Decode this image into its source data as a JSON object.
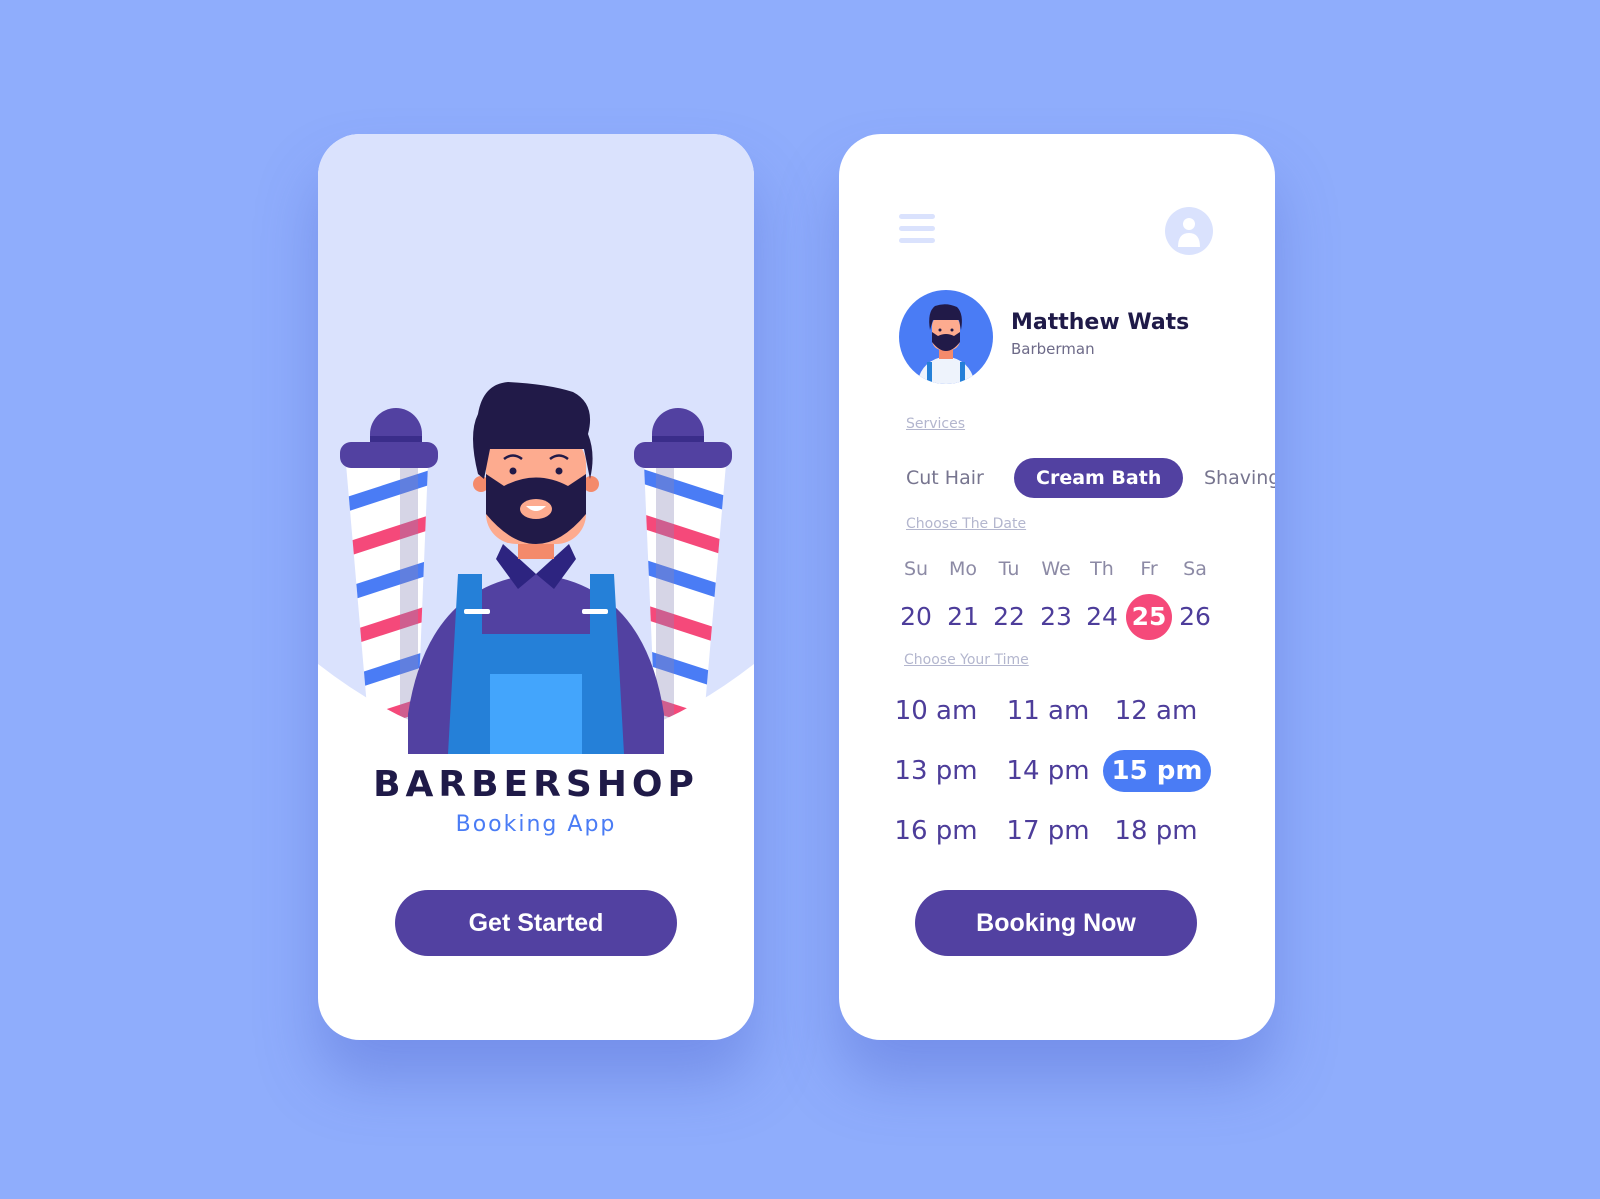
{
  "colors": {
    "background": "#8fadfc",
    "primary": "#5241a1",
    "accent_blue": "#4a7cf5",
    "accent_pink": "#f5497a",
    "hero_bg": "#dae2fd",
    "dark_text": "#1f1a48"
  },
  "welcome_screen": {
    "title": "BARBERSHOP",
    "subtitle": "Booking App",
    "cta_label": "Get Started",
    "illustration": "barber-man-with-barber-poles"
  },
  "booking_screen": {
    "menu_icon": "hamburger-menu-icon",
    "profile_icon": "user-profile-icon",
    "barber": {
      "name": "Matthew Wats",
      "role": "Barberman"
    },
    "services_label": "Services",
    "services": [
      {
        "label": "Cut Hair",
        "selected": false
      },
      {
        "label": "Cream Bath",
        "selected": true
      },
      {
        "label": "Shaving",
        "selected": false
      }
    ],
    "date_label": "Choose The Date",
    "days": [
      {
        "name": "Su",
        "num": "20",
        "selected": false
      },
      {
        "name": "Mo",
        "num": "21",
        "selected": false
      },
      {
        "name": "Tu",
        "num": "22",
        "selected": false
      },
      {
        "name": "We",
        "num": "23",
        "selected": false
      },
      {
        "name": "Th",
        "num": "24",
        "selected": false
      },
      {
        "name": "Fr",
        "num": "25",
        "selected": true
      },
      {
        "name": "Sa",
        "num": "26",
        "selected": false
      }
    ],
    "time_label": "Choose Your Time",
    "times": [
      {
        "label": "10 am",
        "selected": false
      },
      {
        "label": "11 am",
        "selected": false
      },
      {
        "label": "12 am",
        "selected": false
      },
      {
        "label": "13 pm",
        "selected": false
      },
      {
        "label": "14 pm",
        "selected": false
      },
      {
        "label": "15 pm",
        "selected": true
      },
      {
        "label": "16 pm",
        "selected": false
      },
      {
        "label": "17 pm",
        "selected": false
      },
      {
        "label": "18 pm",
        "selected": false
      }
    ],
    "cta_label": "Booking Now"
  }
}
